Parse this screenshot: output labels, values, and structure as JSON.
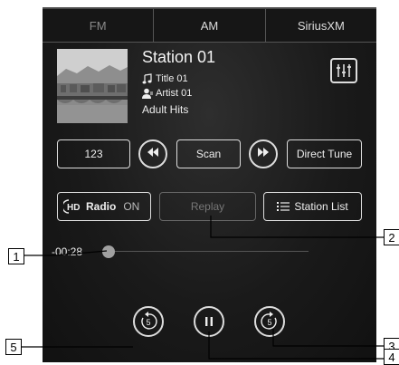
{
  "tabs": [
    {
      "label": "FM",
      "active": true
    },
    {
      "label": "AM",
      "active": false
    },
    {
      "label": "SiriusXM",
      "active": false
    }
  ],
  "station": {
    "name": "Station 01",
    "title": "Title 01",
    "artist": "Artist 01",
    "genre": "Adult Hits"
  },
  "controls": {
    "presets_label": "123",
    "scan_label": "Scan",
    "direct_tune_label": "Direct Tune",
    "hd_radio_label": "Radio",
    "hd_radio_state": "ON",
    "replay_label": "Replay",
    "station_list_label": "Station List"
  },
  "playback": {
    "time": "-00:28",
    "skip_back_seconds": "5",
    "skip_forward_seconds": "5",
    "progress": 0.02
  },
  "callouts": [
    "1",
    "2",
    "3",
    "4",
    "5"
  ],
  "colors": {
    "screen_bg": "#1a1a1a",
    "text": "#eeeeee",
    "border": "#dddddd",
    "disabled": "#777777"
  },
  "icons": [
    "music-note-icon",
    "artist-icon",
    "equalizer-icon",
    "seek-back-icon",
    "seek-forward-icon",
    "hd-icon",
    "list-icon",
    "skip-back-5-icon",
    "pause-icon",
    "skip-forward-5-icon"
  ]
}
